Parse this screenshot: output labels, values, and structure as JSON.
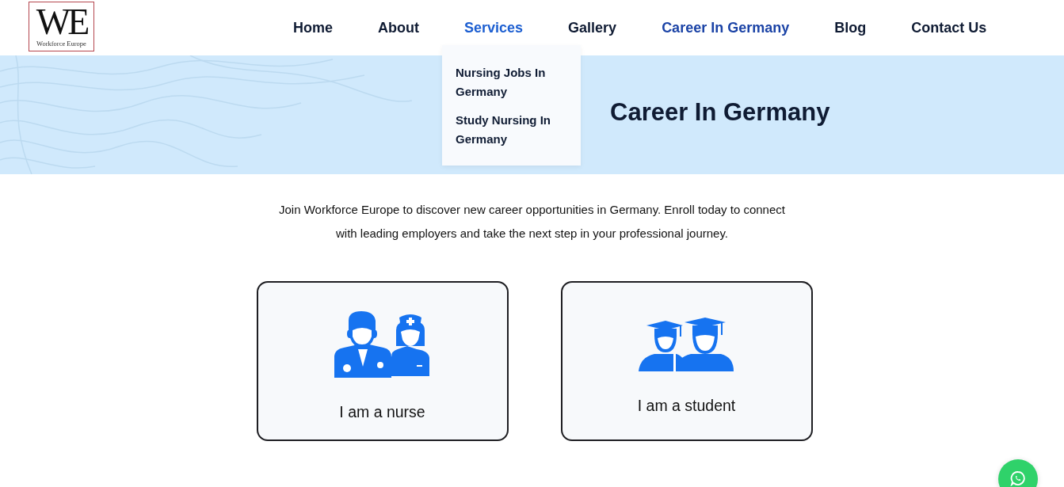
{
  "logo": {
    "initials": "WE",
    "name": "Workforce Europe"
  },
  "nav": [
    {
      "label": "Home",
      "selected": false,
      "expanded": false
    },
    {
      "label": "About",
      "selected": false,
      "expanded": false
    },
    {
      "label": "Services",
      "selected": false,
      "expanded": true
    },
    {
      "label": "Gallery",
      "selected": false,
      "expanded": false
    },
    {
      "label": "Career In Germany",
      "selected": true,
      "expanded": false
    },
    {
      "label": "Blog",
      "selected": false,
      "expanded": false
    },
    {
      "label": "Contact Us",
      "selected": false,
      "expanded": false
    }
  ],
  "dropdown": [
    "Nursing Jobs In Germany",
    "Study Nursing In Germany"
  ],
  "hero": {
    "title": "Career In Germany"
  },
  "intro": "Join Workforce Europe to discover new career opportunities in Germany. Enroll today to connect with leading employers and take the next step in your professional journey.",
  "cards": [
    {
      "kind": "nurse",
      "label": "I am a nurse"
    },
    {
      "kind": "student",
      "label": "I am a student"
    }
  ]
}
